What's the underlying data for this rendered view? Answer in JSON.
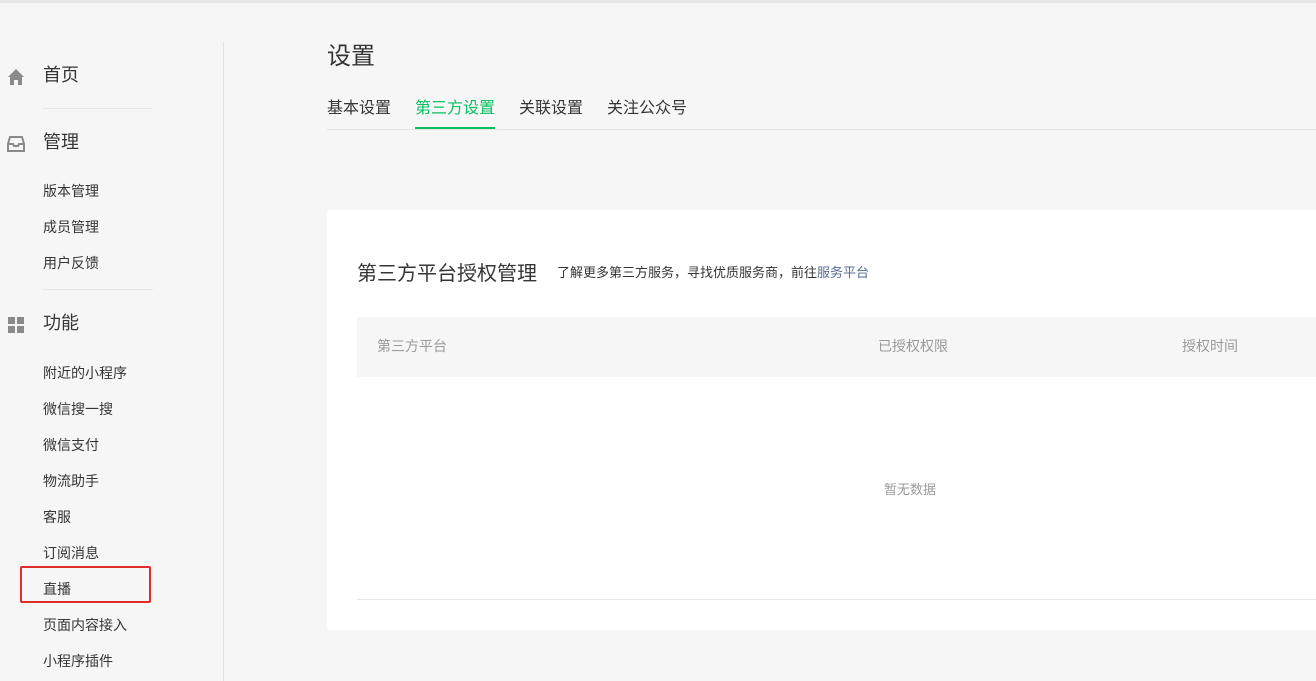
{
  "sidebar": {
    "home": {
      "label": "首页",
      "icon": "home-icon"
    },
    "manage": {
      "label": "管理",
      "icon": "inbox-icon",
      "items": [
        "版本管理",
        "成员管理",
        "用户反馈"
      ]
    },
    "features": {
      "label": "功能",
      "icon": "grid-icon",
      "items": [
        "附近的小程序",
        "微信搜一搜",
        "微信支付",
        "物流助手",
        "客服",
        "订阅消息",
        "直播",
        "页面内容接入",
        "小程序插件"
      ]
    },
    "highlighted_item": "直播"
  },
  "main": {
    "title": "设置",
    "tabs": [
      "基本设置",
      "第三方设置",
      "关联设置",
      "关注公众号"
    ],
    "active_tab": "第三方设置",
    "card": {
      "title": "第三方平台授权管理",
      "desc_prefix": "了解更多第三方服务，寻找优质服务商，前往",
      "desc_link": "服务平台",
      "columns": [
        "第三方平台",
        "已授权权限",
        "授权时间"
      ],
      "empty_text": "暂无数据"
    }
  },
  "colors": {
    "accent": "#07c160",
    "link": "#576b95",
    "highlight_border": "#e02b2b"
  }
}
